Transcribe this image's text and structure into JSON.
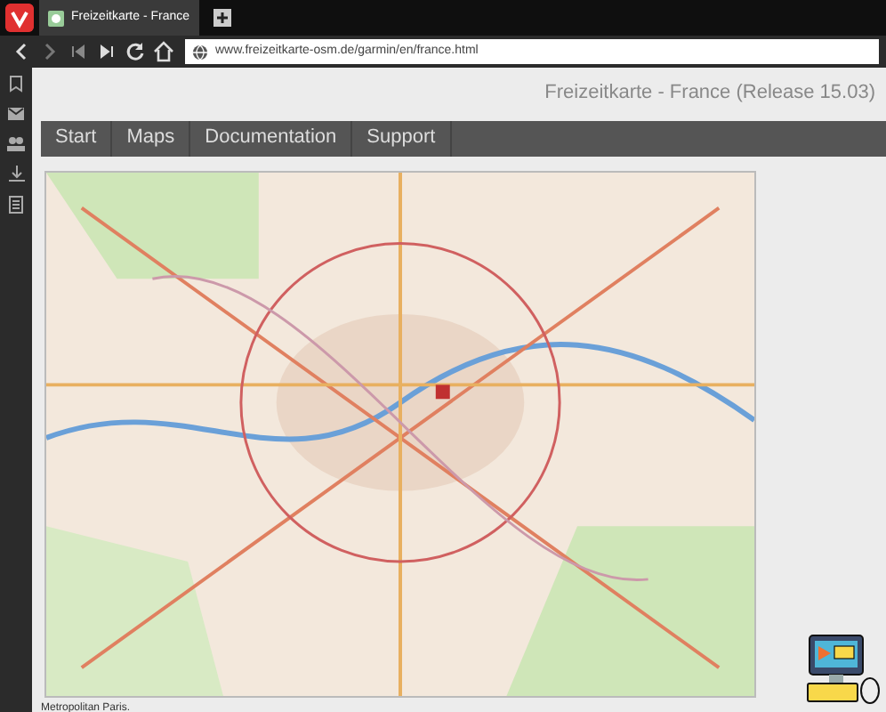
{
  "browser": {
    "tab": {
      "title": "Freizeitkarte - France",
      "selected": true
    },
    "url": "www.freizeitkarte-osm.de/garmin/en/france.html"
  },
  "page": {
    "title": "Freizeitkarte - France (Release 15.03)",
    "menu": [
      {
        "label": "Start"
      },
      {
        "label": "Maps"
      },
      {
        "label": "Documentation"
      },
      {
        "label": "Support"
      }
    ],
    "caption": "Metropolitan Paris."
  }
}
